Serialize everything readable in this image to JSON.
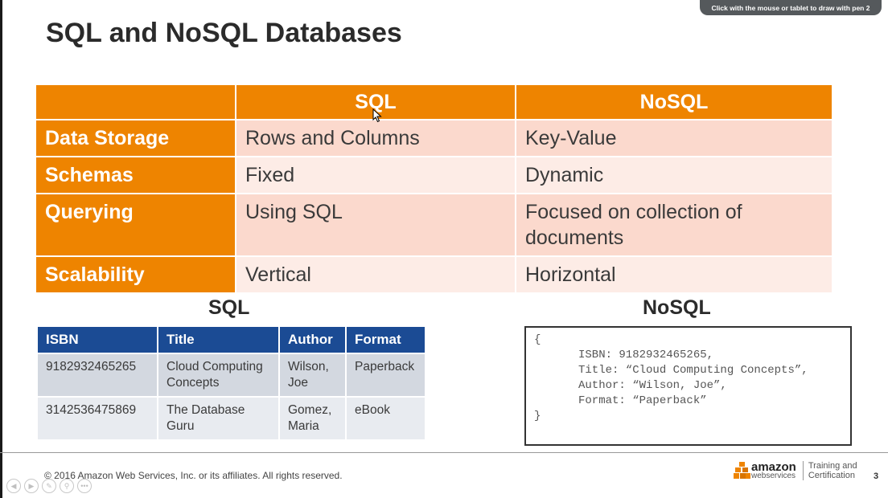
{
  "pen_hint": "Click with the mouse or tablet to draw with pen 2",
  "slide_title": "SQL and NoSQL Databases",
  "comparison": {
    "headers": [
      "",
      "SQL",
      "NoSQL"
    ],
    "rows": [
      {
        "label": "Data Storage",
        "sql": "Rows and Columns",
        "nosql": "Key-Value"
      },
      {
        "label": "Schemas",
        "sql": "Fixed",
        "nosql": "Dynamic"
      },
      {
        "label": "Querying",
        "sql": "Using SQL",
        "nosql": "Focused on collection of documents"
      },
      {
        "label": "Scalability",
        "sql": "Vertical",
        "nosql": "Horizontal"
      }
    ]
  },
  "sql_example": {
    "heading": "SQL",
    "columns": [
      "ISBN",
      "Title",
      "Author",
      "Format"
    ],
    "rows": [
      [
        "9182932465265",
        "Cloud Computing Concepts",
        "Wilson, Joe",
        "Paperback"
      ],
      [
        "3142536475869",
        "The Database Guru",
        "Gomez, Maria",
        "eBook"
      ]
    ]
  },
  "nosql_example": {
    "heading": "NoSQL",
    "open": "{",
    "lines": [
      "ISBN: 9182932465265,",
      "Title: “Cloud Computing Concepts”,",
      "Author: “Wilson, Joe”,",
      "Format: “Paperback”"
    ],
    "close": "}"
  },
  "footer": {
    "copyright": "© 2016 Amazon Web Services, Inc. or its affiliates. All rights reserved.",
    "logo_word": "amazon",
    "logo_sub": "webservices",
    "logo_tag_1": "Training and",
    "logo_tag_2": "Certification",
    "page_number": "3"
  },
  "nav_controls": [
    "prev-icon",
    "next-icon",
    "pen-icon",
    "zoom-icon",
    "more-icon"
  ],
  "colors": {
    "accent": "#ee8400",
    "header_blue": "#1b4b94"
  }
}
